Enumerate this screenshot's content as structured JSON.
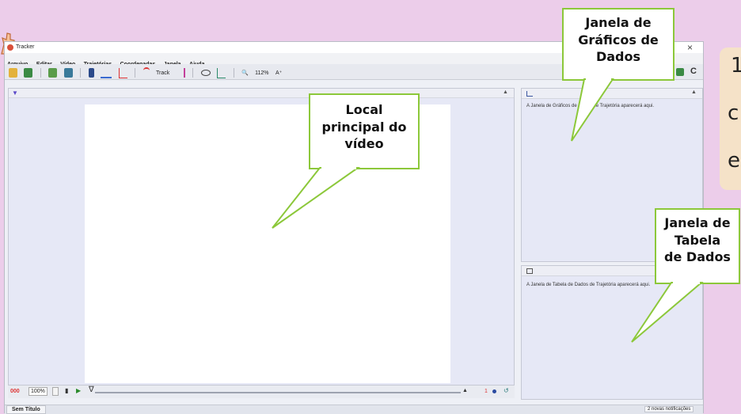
{
  "window": {
    "title": "Tracker",
    "close_glyph": "×",
    "menu": [
      "Arquivo",
      "Editar",
      "Vídeo",
      "Trajetórias",
      "Coordenadas",
      "Janela",
      "Ajuda"
    ]
  },
  "toolbar": {
    "track_label": "Track",
    "zoom_label": "112%",
    "font_label": "A⁺",
    "refresh_glyph": "C"
  },
  "plot_panel": {
    "message": "A Janela de Gráficos de Dados de Trajetória aparecerá aqui."
  },
  "table_panel": {
    "message": "A Janela de Tabela de Dados de Trajetória aparecerá aqui."
  },
  "player": {
    "frame_counter": "000",
    "rate_value": "100%",
    "step_size": "1"
  },
  "status": {
    "tab_label": "Sem Título",
    "notifications": "2 novas notificações"
  },
  "callouts": {
    "video": [
      "Local",
      "principal do",
      "vídeo"
    ],
    "plots": [
      "Janela de",
      "Gráficos de",
      "Dados"
    ],
    "table": [
      "Janela de",
      "Tabela",
      "de Dados"
    ]
  },
  "side_text": [
    "1",
    "c",
    "e"
  ],
  "colors": {
    "background": "#eccdea",
    "callout_border": "#8cc83a",
    "accent_red": "#d33",
    "side_box": "#f5e2c8"
  }
}
